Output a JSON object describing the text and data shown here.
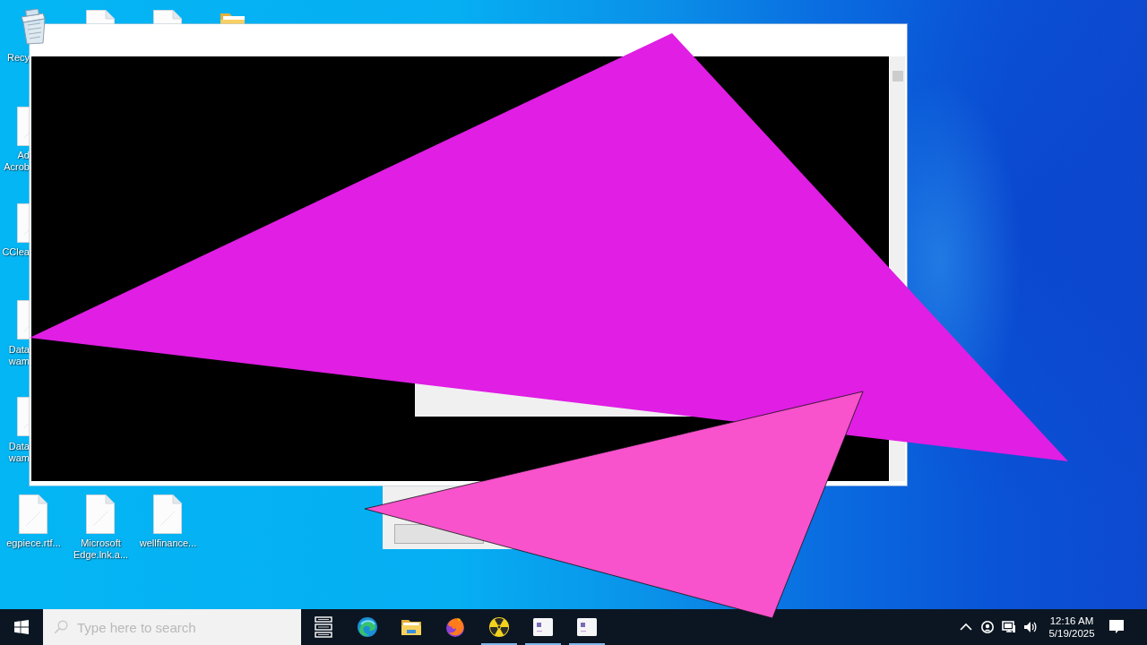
{
  "desktop": {
    "icons": [
      {
        "kind": "recycle-bin",
        "label": "Recy"
      },
      {
        "kind": "document"
      },
      {
        "kind": "document"
      },
      {
        "kind": "folder"
      },
      {
        "kind": "document",
        "label": "Ad\nAcrob"
      },
      {
        "kind": "document",
        "label": "CClea"
      },
      {
        "kind": "document",
        "label": "Data\nwam"
      },
      {
        "kind": "document",
        "label": "Data\nwam"
      },
      {
        "kind": "document",
        "label": "egpiece.rtf..."
      },
      {
        "kind": "document",
        "label": "Microsoft\nEdge.lnk.a..."
      },
      {
        "kind": "document",
        "label": "wellfinance..."
      }
    ]
  },
  "taskbar": {
    "search": {
      "placeholder": "Type here to search"
    },
    "apps": [
      {
        "kind": "taskview",
        "running": false
      },
      {
        "kind": "swirl",
        "running": false
      },
      {
        "kind": "folder",
        "running": false
      },
      {
        "kind": "fireball",
        "running": false
      },
      {
        "kind": "radiation",
        "running": true
      },
      {
        "kind": "window",
        "running": true
      },
      {
        "kind": "window",
        "running": true
      }
    ],
    "tray": {
      "time": "12:16 AM",
      "date": "5/19/2025"
    }
  }
}
